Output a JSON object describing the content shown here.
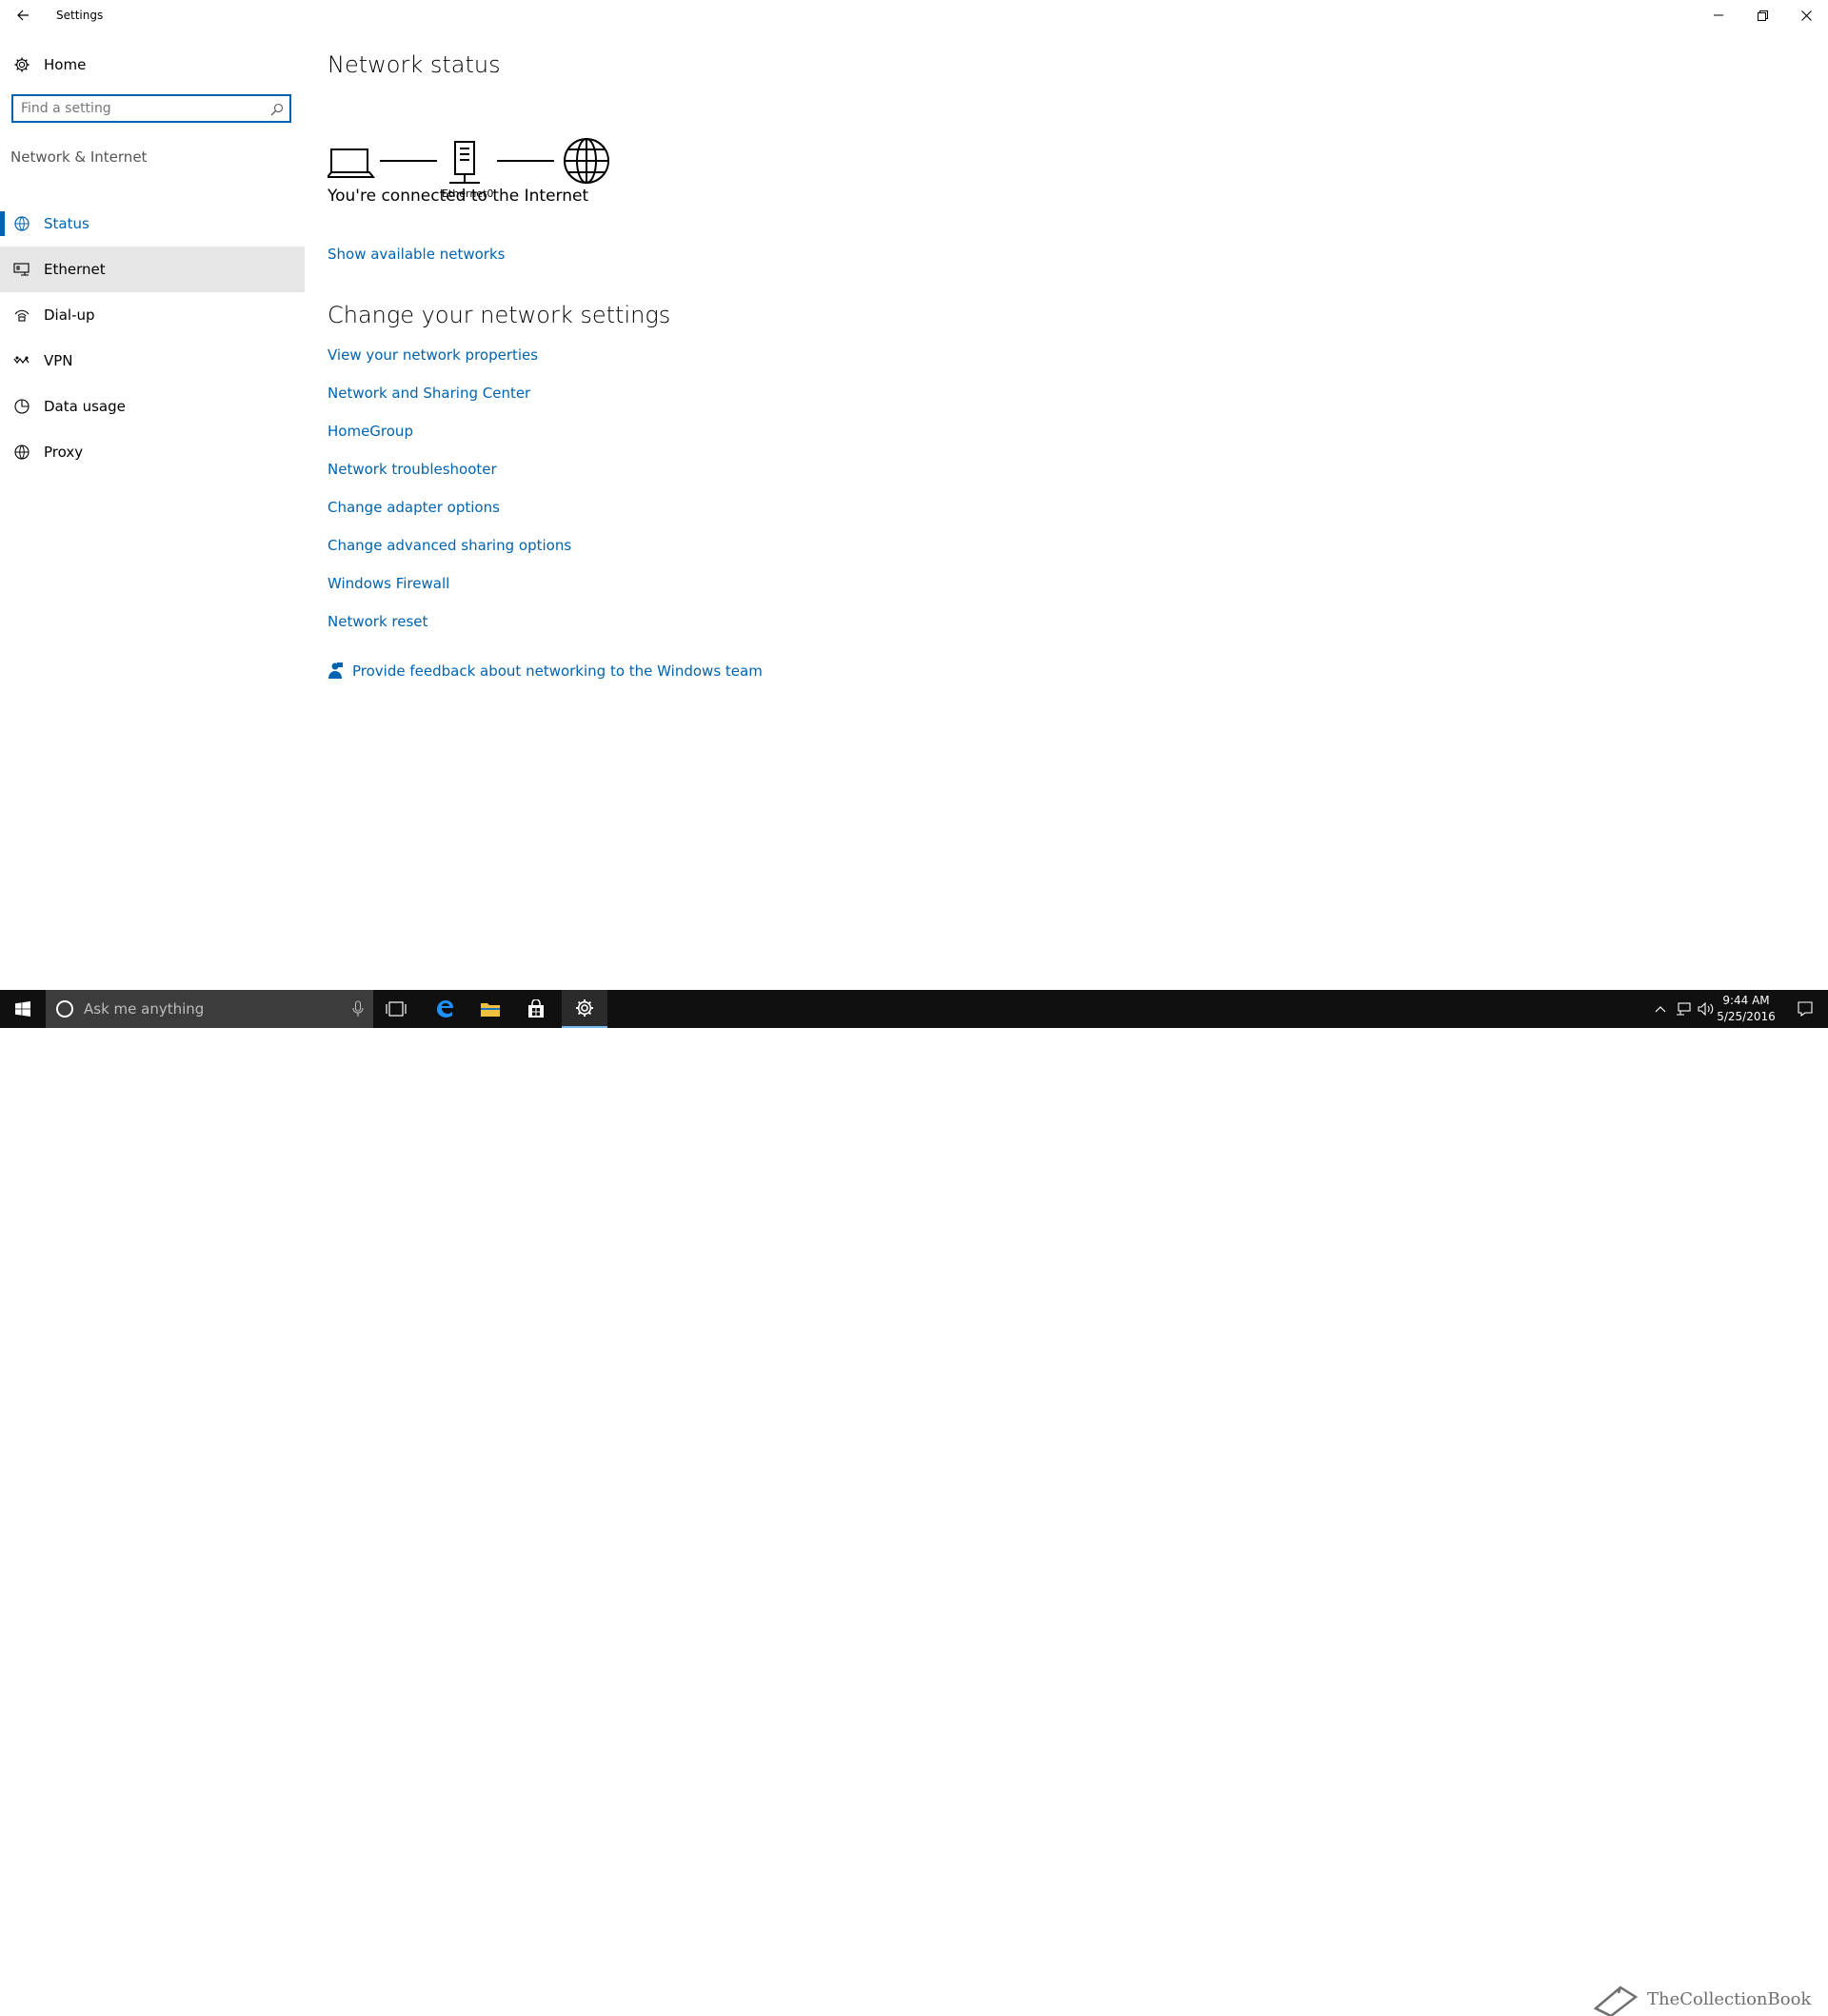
{
  "window": {
    "title": "Settings",
    "back_icon": "arrow-left-icon",
    "minimize_icon": "minimize-icon",
    "restore_icon": "restore-icon",
    "close_icon": "close-icon"
  },
  "sidebar": {
    "home_label": "Home",
    "home_icon": "gear-icon",
    "search_placeholder": "Find a setting",
    "search_icon": "search-icon",
    "group_label": "Network & Internet",
    "items": [
      {
        "label": "Status",
        "icon": "status-globe-icon",
        "selected": true
      },
      {
        "label": "Ethernet",
        "icon": "ethernet-icon",
        "hovered": true
      },
      {
        "label": "Dial-up",
        "icon": "dialup-icon"
      },
      {
        "label": "VPN",
        "icon": "vpn-icon"
      },
      {
        "label": "Data usage",
        "icon": "data-usage-icon"
      },
      {
        "label": "Proxy",
        "icon": "proxy-globe-icon"
      }
    ]
  },
  "main": {
    "heading": "Network status",
    "diagram": {
      "adapter_label": "Ethernet0",
      "icons": [
        "laptop-icon",
        "network-adapter-icon",
        "internet-globe-icon"
      ]
    },
    "connection_status": "You're connected to the Internet",
    "show_networks_link": "Show available networks",
    "settings_heading": "Change your network settings",
    "links": [
      "View your network properties",
      "Network and Sharing Center",
      "HomeGroup",
      "Network troubleshooter",
      "Change adapter options",
      "Change advanced sharing options",
      "Windows Firewall",
      "Network reset"
    ],
    "feedback_link": "Provide feedback about networking to the Windows team",
    "feedback_icon": "feedback-person-icon"
  },
  "taskbar": {
    "start_icon": "windows-start-icon",
    "cortana_placeholder": "Ask me anything",
    "cortana_icon": "cortana-circle-icon",
    "mic_icon": "microphone-icon",
    "pinned": [
      "task-view-icon",
      "edge-icon",
      "file-explorer-icon",
      "store-icon",
      "settings-gear-icon"
    ],
    "active_app": "settings-gear-icon",
    "tray_icons": [
      "chevron-up-icon",
      "network-tray-icon",
      "volume-icon",
      "action-center-icon"
    ],
    "time": "9:44 AM",
    "date": "5/25/2016",
    "watermark_text": "TheCollectionBook",
    "watermark_icon": "book-icon",
    "colors": {
      "background": "#101010",
      "search_box": "#3c3c3c",
      "active_underline": "#76b9ed"
    }
  },
  "colors": {
    "accent": "#0063b1",
    "hover_bg": "#e6e6e6",
    "text": "#000000",
    "muted": "#555555"
  }
}
